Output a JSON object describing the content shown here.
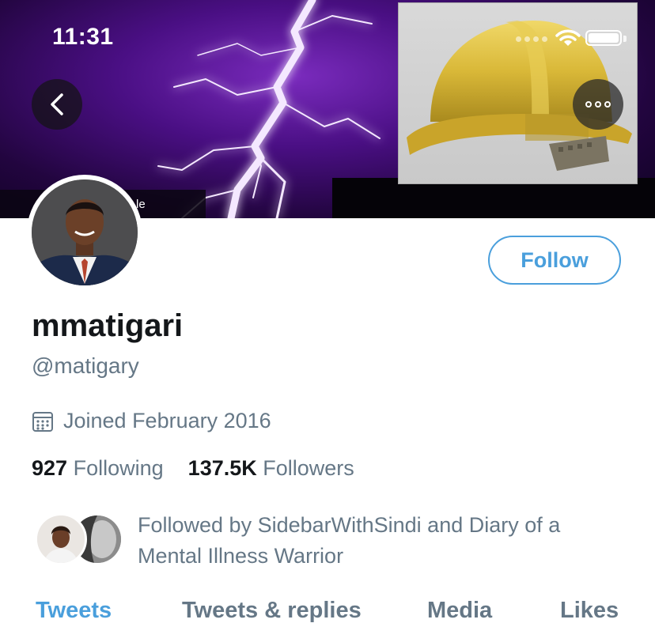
{
  "status_bar": {
    "time": "11:31"
  },
  "banner": {
    "text_fragment": "le"
  },
  "icons": {
    "back": "chevron-left-icon",
    "more": "more-dots-icon",
    "calendar": "calendar-icon",
    "wifi": "wifi-icon",
    "battery": "battery-icon"
  },
  "profile": {
    "display_name": "mmatigari",
    "handle": "@matigary",
    "follow_label": "Follow",
    "joined": "Joined February 2016",
    "following_count": "927",
    "following_label": "Following",
    "followers_count": "137.5K",
    "followers_label": "Followers",
    "followed_by": "Followed by SidebarWithSindi and Diary of a Mental Illness Warrior"
  },
  "tabs": [
    "Tweets",
    "Tweets & replies",
    "Media",
    "Likes"
  ],
  "active_tab": "Tweets",
  "colors": {
    "accent": "#4a9fdc",
    "secondary_text": "#657786",
    "primary_text": "#14171a",
    "banner_purple": "#4a0f84",
    "helmet_yellow": "#d9b838"
  }
}
